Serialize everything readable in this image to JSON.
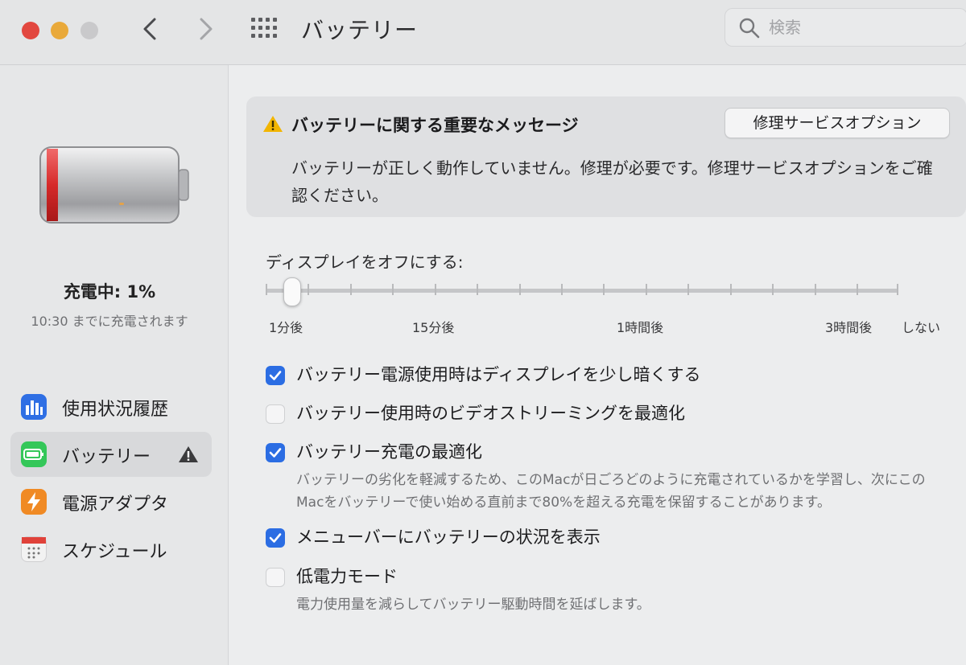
{
  "window": {
    "title": "バッテリー"
  },
  "search": {
    "placeholder": "検索"
  },
  "sidebar": {
    "charge_status": "充電中: 1%",
    "charge_sub": "10:30 までに充電されます",
    "items": [
      {
        "label": "使用状況履歴",
        "icon": "bar-chart-icon",
        "color": "#2f6fe4"
      },
      {
        "label": "バッテリー",
        "icon": "battery-icon",
        "color": "#34c759"
      },
      {
        "label": "電源アダプタ",
        "icon": "bolt-icon",
        "color": "#f08a24"
      },
      {
        "label": "スケジュール",
        "icon": "calendar-icon",
        "color": "#f2f2f2"
      }
    ]
  },
  "alert": {
    "title": "バッテリーに関する重要なメッセージ",
    "button": "修理サービスオプション",
    "body": "バッテリーが正しく動作していません。修理が必要です。修理サービスオプションをご確認ください。"
  },
  "display_off": {
    "label": "ディスプレイをオフにする:",
    "ticks": [
      "1分後",
      "15分後",
      "1時間後",
      "3時間後",
      "しない"
    ],
    "selected": "1分後"
  },
  "options": [
    {
      "label": "バッテリー電源使用時はディスプレイを少し暗くする",
      "checked": true
    },
    {
      "label": "バッテリー使用時のビデオストリーミングを最適化",
      "checked": false
    },
    {
      "label": "バッテリー充電の最適化",
      "checked": true,
      "description": "バッテリーの劣化を軽減するため、このMacが日ごろどのように充電されているかを学習し、次にこのMacをバッテリーで使い始める直前まで80%を超える充電を保留することがあります。"
    },
    {
      "label": "メニューバーにバッテリーの状況を表示",
      "checked": true
    },
    {
      "label": "低電力モード",
      "checked": false,
      "description": "電力使用量を減らしてバッテリー駆動時間を延ばします。"
    }
  ],
  "colors": {
    "accent": "#2b6de3",
    "warning": "#f2b500",
    "battery_red": "#d62a2a"
  }
}
